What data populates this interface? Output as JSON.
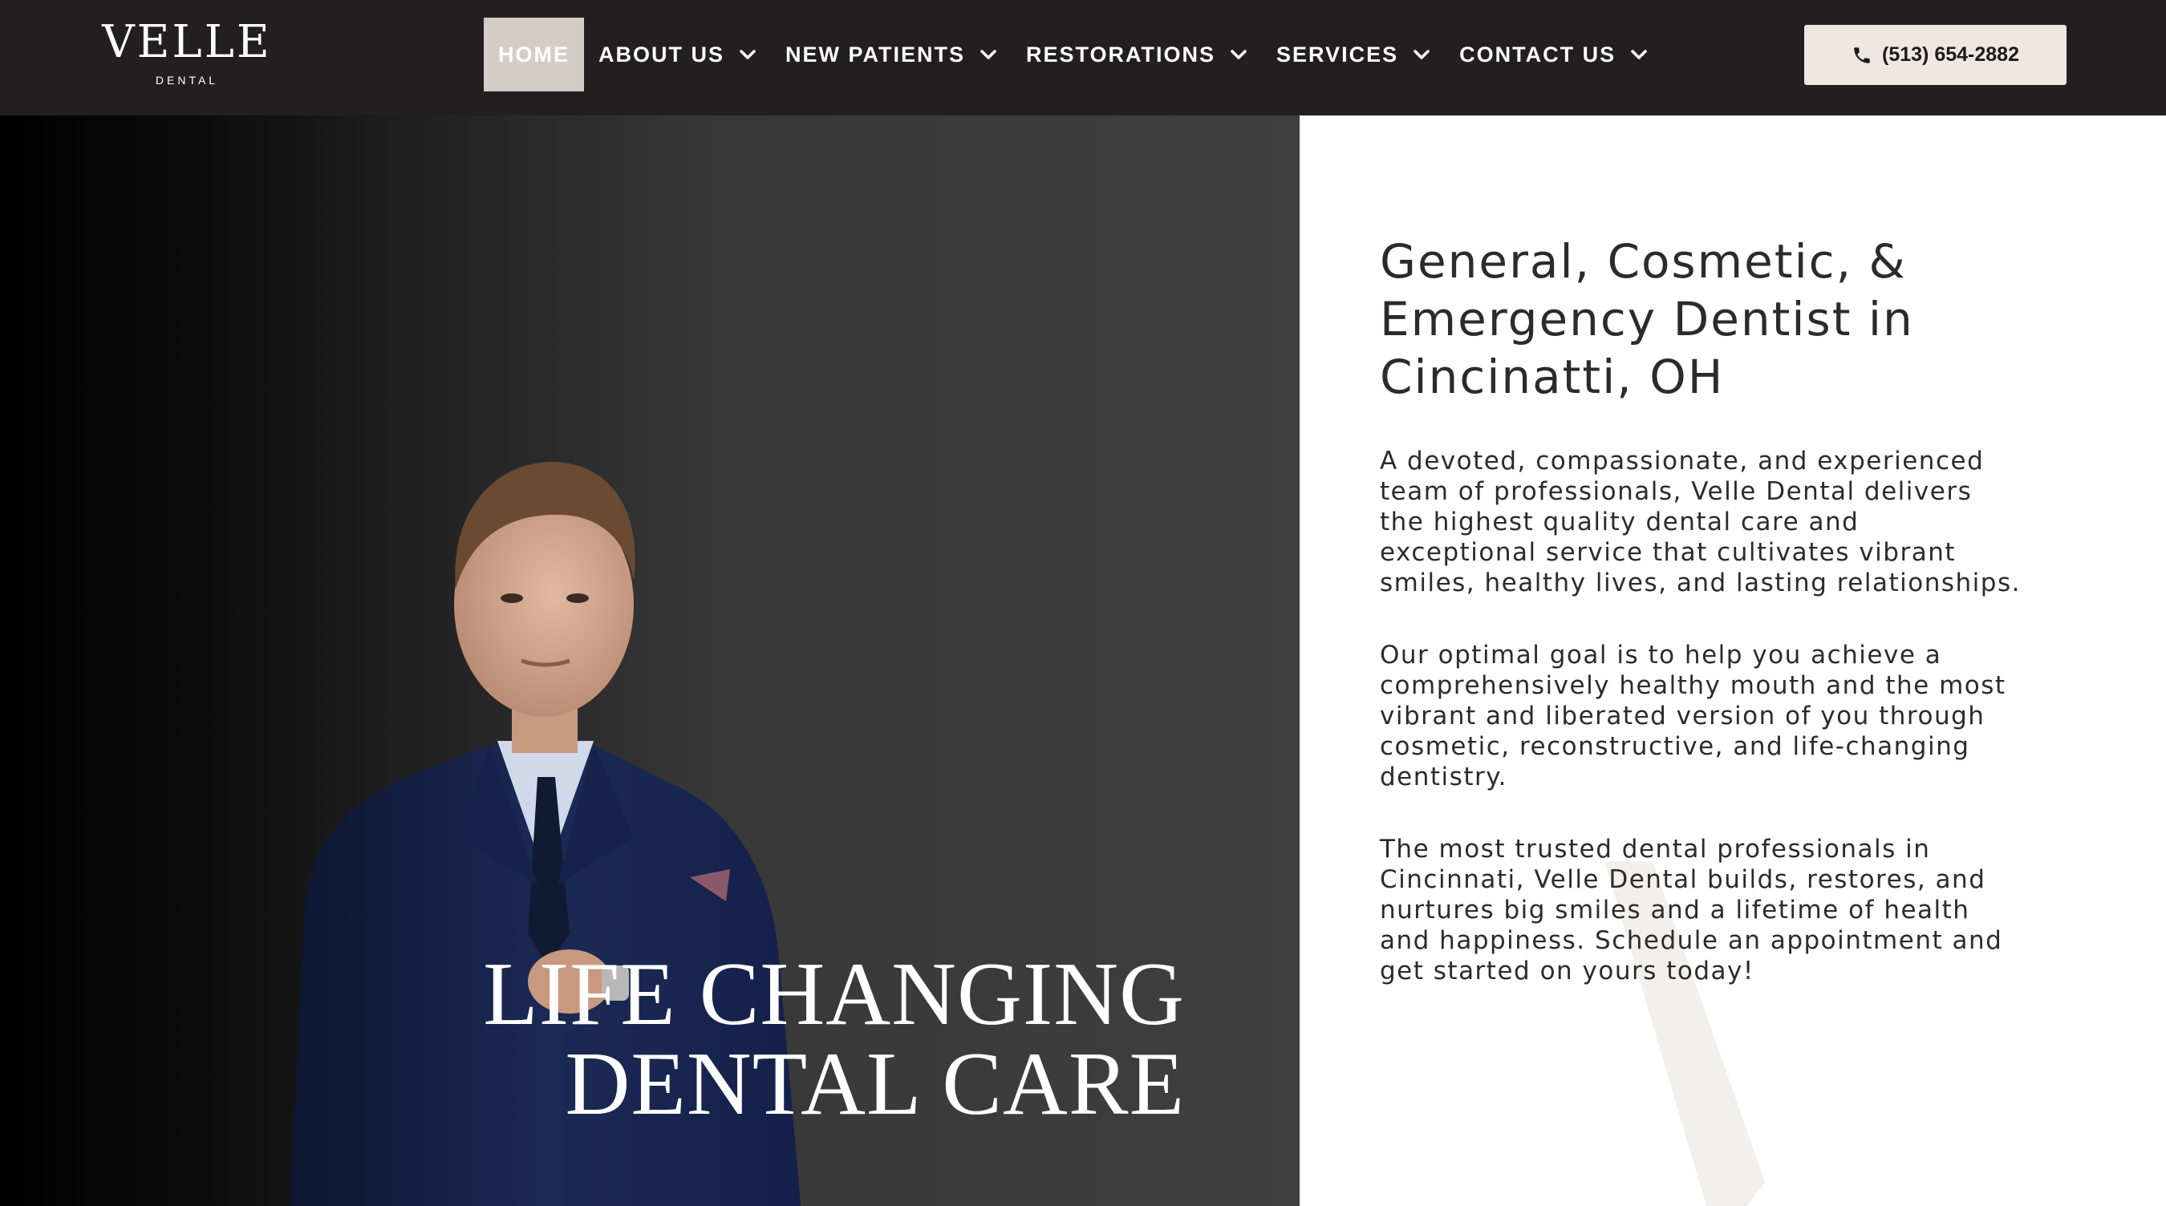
{
  "brand": {
    "name": "VELLE",
    "tagline": "DENTAL"
  },
  "nav": {
    "items": [
      {
        "label": "HOME",
        "active": true,
        "dropdown": false
      },
      {
        "label": "ABOUT US",
        "active": false,
        "dropdown": true
      },
      {
        "label": "NEW PATIENTS",
        "active": false,
        "dropdown": true
      },
      {
        "label": "RESTORATIONS",
        "active": false,
        "dropdown": true
      },
      {
        "label": "SERVICES",
        "active": false,
        "dropdown": true
      },
      {
        "label": "CONTACT US",
        "active": false,
        "dropdown": true
      }
    ],
    "dropdown_icon": "chevron-down-icon"
  },
  "phone": {
    "label": "(513) 654-2882",
    "icon": "phone-icon"
  },
  "hero": {
    "title_line1": "LIFE CHANGING",
    "title_line2": "DENTAL CARE"
  },
  "intro": {
    "headline": "General, Cosmetic, & Emergency Dentist in Cincinatti, OH",
    "paragraphs": [
      "A devoted, compassionate, and experienced team of professionals, Velle Dental delivers the highest quality dental care and exceptional service that cultivates vibrant smiles, healthy lives, and lasting relationships.",
      "Our optimal goal is to help you achieve a comprehensively healthy mouth and the most vibrant and liberated version of you through cosmetic, reconstructive, and life-changing dentistry.",
      "The most trusted dental professionals in Cincinnati, Velle Dental builds, restores, and nurtures big smiles and a lifetime of health and happiness. Schedule an appointment and get started on yours today!"
    ]
  },
  "colors": {
    "header_bg": "#231f20",
    "active_tab_bg": "#d2cdc7",
    "phone_button_bg": "#ede8e2",
    "hero_bg": "#3f3f3f",
    "text_dark": "#2d2a2b"
  }
}
